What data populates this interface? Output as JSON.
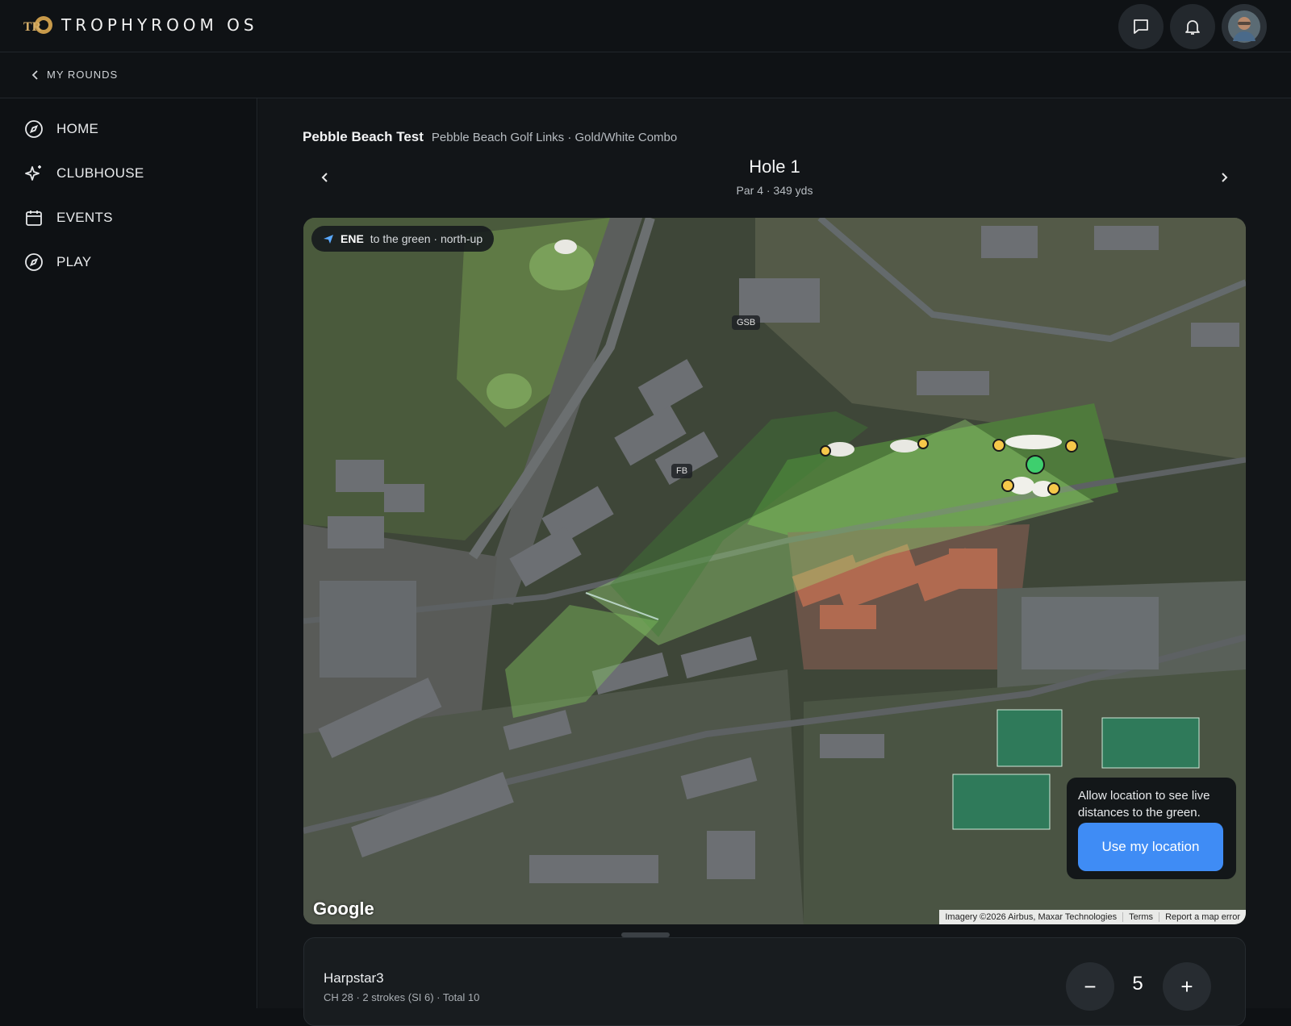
{
  "app": {
    "brand": "TROPHYROOM OS",
    "logo_text": "TRO"
  },
  "header": {
    "actions": [
      "chat-icon",
      "bell-icon",
      "avatar"
    ]
  },
  "breadcrumb": {
    "back_label": "MY ROUNDS"
  },
  "sidebar": {
    "items": [
      {
        "label": "HOME",
        "icon": "compass-icon"
      },
      {
        "label": "CLUBHOUSE",
        "icon": "sparkle-icon"
      },
      {
        "label": "EVENTS",
        "icon": "calendar-icon"
      },
      {
        "label": "PLAY",
        "icon": "compass-icon"
      }
    ]
  },
  "round": {
    "name": "Pebble Beach Test",
    "course": "Pebble Beach Golf Links · Gold/White Combo"
  },
  "hole": {
    "title": "Hole 1",
    "subtitle": "Par 4 · 349 yds"
  },
  "map": {
    "direction": "ENE",
    "direction_text": "to the green · north-up",
    "labels": [
      "GSB",
      "FB"
    ],
    "google": "Google",
    "attribution": [
      "Imagery ©2026 Airbus, Maxar Technologies",
      "Terms",
      "Report a map error"
    ],
    "location_prompt": "Allow location to see live distances to the green.",
    "location_button": "Use my location",
    "colors": {
      "green_marker": "#3ecf6e",
      "hazard_marker": "#f6c84a",
      "button": "#3f8cf5"
    }
  },
  "scorecard": {
    "player": "Harpstar3",
    "details": "CH 28 · 2 strokes (SI 6) · Total 10",
    "score": "5",
    "minus": "−",
    "plus": "+"
  }
}
